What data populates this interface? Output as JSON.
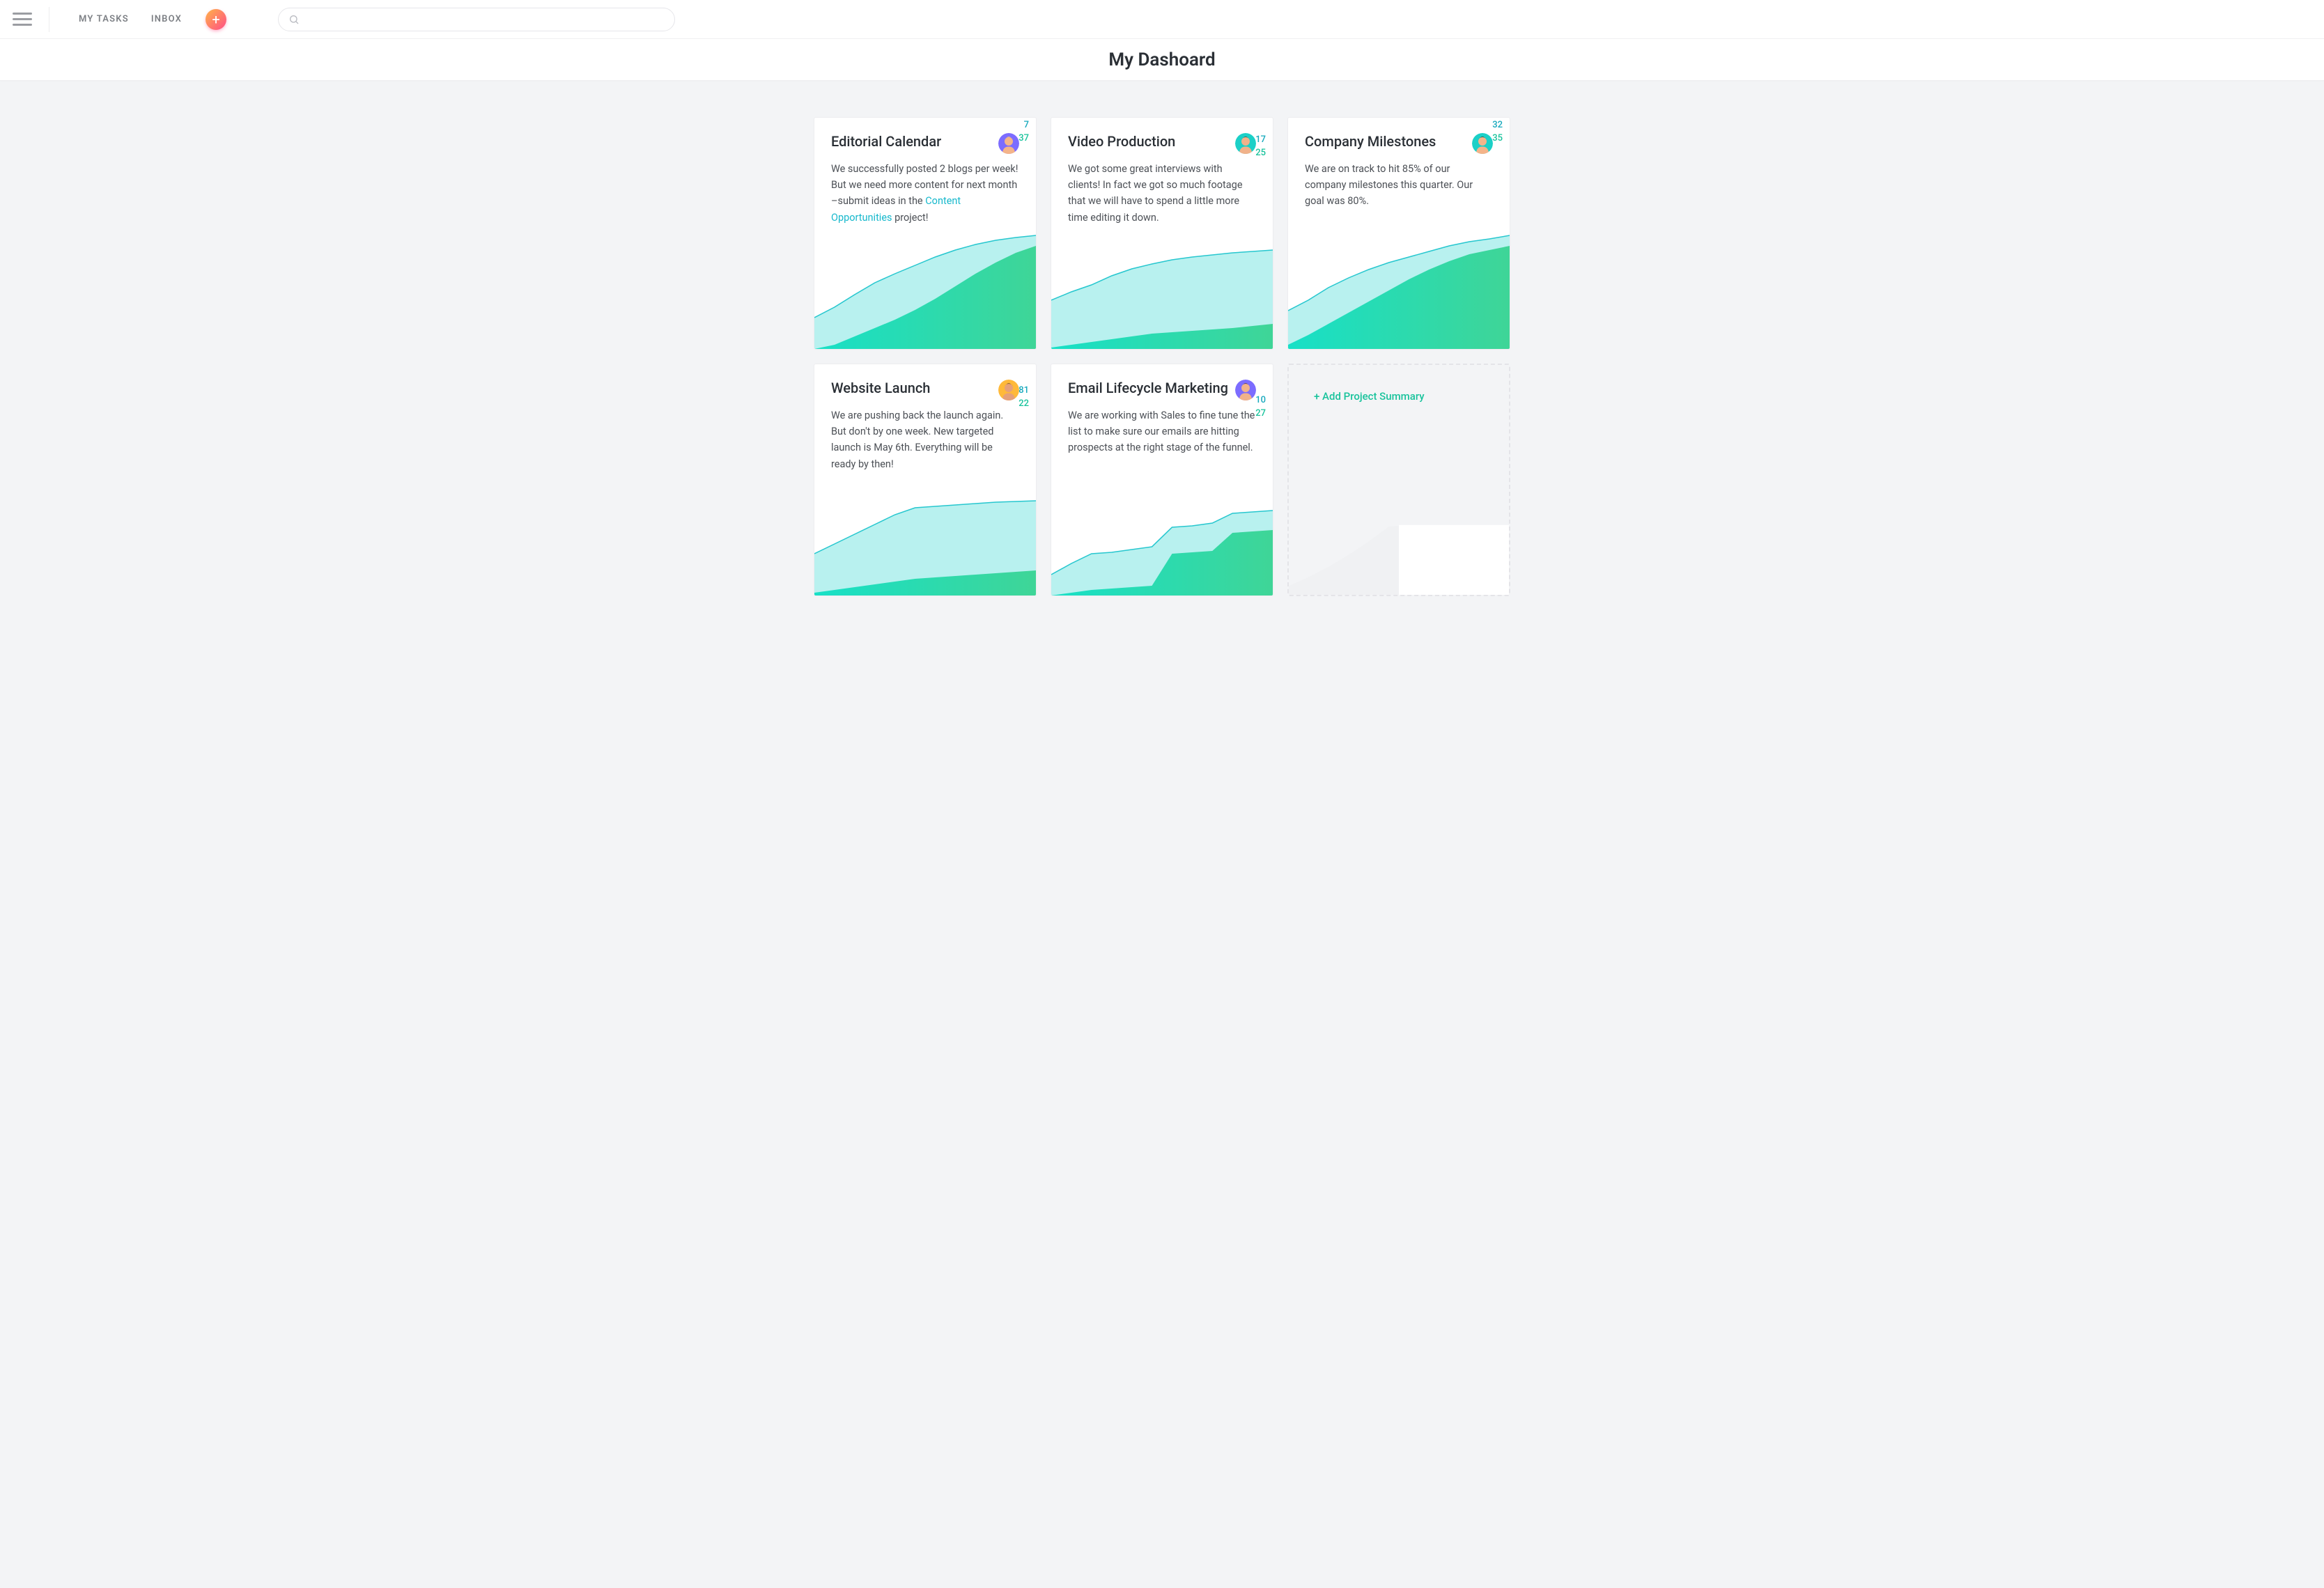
{
  "nav": {
    "my_tasks": "MY TASKS",
    "inbox": "INBOX"
  },
  "search": {
    "placeholder": ""
  },
  "page_title": "My Dashoard",
  "add_project_label": "+ Add Project Summary",
  "cards": [
    {
      "title": "Editorial Calendar",
      "body_pre": "We successfully posted 2 blogs per week! But we need more content for next month –submit ideas in the ",
      "link_text": "Content Opportunities",
      "body_post": " project!",
      "value_top": "7",
      "value_bottom": "37",
      "avatar": {
        "bg": "#7c6cff",
        "hair": "#f3c97b",
        "skin": "#f4b48a"
      }
    },
    {
      "title": "Video Production",
      "body_pre": "We got some great interviews with clients! In fact we got so much footage that we will have to spend a little more time editing it down.",
      "link_text": "",
      "body_post": "",
      "value_top": "17",
      "value_bottom": "25",
      "avatar": {
        "bg": "#1bd0c7",
        "hair": "#5a3b23",
        "skin": "#f1b28a"
      }
    },
    {
      "title": "Company Milestones",
      "body_pre": "We are on track to hit 85% of our company milestones this quarter. Our goal was 80%.",
      "link_text": "",
      "body_post": "",
      "value_top": "32",
      "value_bottom": "35",
      "avatar": {
        "bg": "#1bd0c7",
        "hair": "#4a2e18",
        "skin": "#f4b48a"
      }
    },
    {
      "title": "Website Launch",
      "body_pre": "We are pushing back the launch again. But don't by one week. New targeted launch is May 6th. Everything will be ready by then!",
      "link_text": "",
      "body_post": "",
      "value_top": "81",
      "value_bottom": "22",
      "avatar": {
        "bg": "#ffb93a",
        "hair": "#6a4321",
        "skin": "#e6a079"
      }
    },
    {
      "title": "Email Lifecycle Marketing",
      "body_pre": "We are working with Sales to fine tune the list to make sure our emails are hitting prospects at the right stage of the funnel.",
      "link_text": "",
      "body_post": "",
      "value_top": "10",
      "value_bottom": "27",
      "avatar": {
        "bg": "#7c6cff",
        "hair": "#5b3a22",
        "skin": "#f1b28a"
      }
    }
  ],
  "chart_data": [
    {
      "type": "area",
      "title": "Editorial Calendar",
      "series": [
        {
          "name": "top",
          "label_value": 7,
          "values": [
            45,
            60,
            78,
            95,
            108,
            120,
            132,
            142,
            150,
            156,
            160,
            163
          ]
        },
        {
          "name": "bottom",
          "label_value": 37,
          "values": [
            0,
            6,
            18,
            30,
            42,
            56,
            72,
            90,
            108,
            124,
            138,
            148
          ]
        }
      ]
    },
    {
      "type": "area",
      "title": "Video Production",
      "series": [
        {
          "name": "top",
          "label_value": 17,
          "values": [
            70,
            82,
            92,
            105,
            115,
            122,
            128,
            132,
            135,
            138,
            140,
            142
          ]
        },
        {
          "name": "bottom",
          "label_value": 25,
          "values": [
            2,
            6,
            10,
            14,
            18,
            22,
            24,
            26,
            28,
            30,
            33,
            36
          ]
        }
      ]
    },
    {
      "type": "area",
      "title": "Company Milestones",
      "series": [
        {
          "name": "top",
          "label_value": 32,
          "values": [
            55,
            70,
            88,
            102,
            114,
            124,
            132,
            140,
            148,
            154,
            158,
            163
          ]
        },
        {
          "name": "bottom",
          "label_value": 35,
          "values": [
            6,
            20,
            36,
            52,
            68,
            84,
            100,
            114,
            126,
            136,
            142,
            148
          ]
        }
      ]
    },
    {
      "type": "area",
      "title": "Website Launch",
      "series": [
        {
          "name": "top",
          "label_value": 81,
          "values": [
            60,
            74,
            88,
            102,
            116,
            126,
            128,
            130,
            132,
            134,
            135,
            136
          ]
        },
        {
          "name": "bottom",
          "label_value": 22,
          "values": [
            4,
            8,
            12,
            16,
            20,
            24,
            26,
            28,
            30,
            32,
            34,
            36
          ]
        }
      ]
    },
    {
      "type": "area",
      "title": "Email Lifecycle Marketing",
      "series": [
        {
          "name": "top",
          "label_value": 10,
          "values": [
            30,
            46,
            60,
            62,
            66,
            70,
            98,
            100,
            104,
            118,
            120,
            122
          ]
        },
        {
          "name": "bottom",
          "label_value": 27,
          "values": [
            0,
            4,
            8,
            10,
            12,
            14,
            60,
            62,
            64,
            90,
            92,
            94
          ]
        }
      ]
    }
  ],
  "ghost_chart": {
    "type": "area",
    "values": [
      12,
      24,
      38,
      54,
      72,
      92,
      94,
      94,
      94,
      94,
      94,
      94
    ]
  }
}
